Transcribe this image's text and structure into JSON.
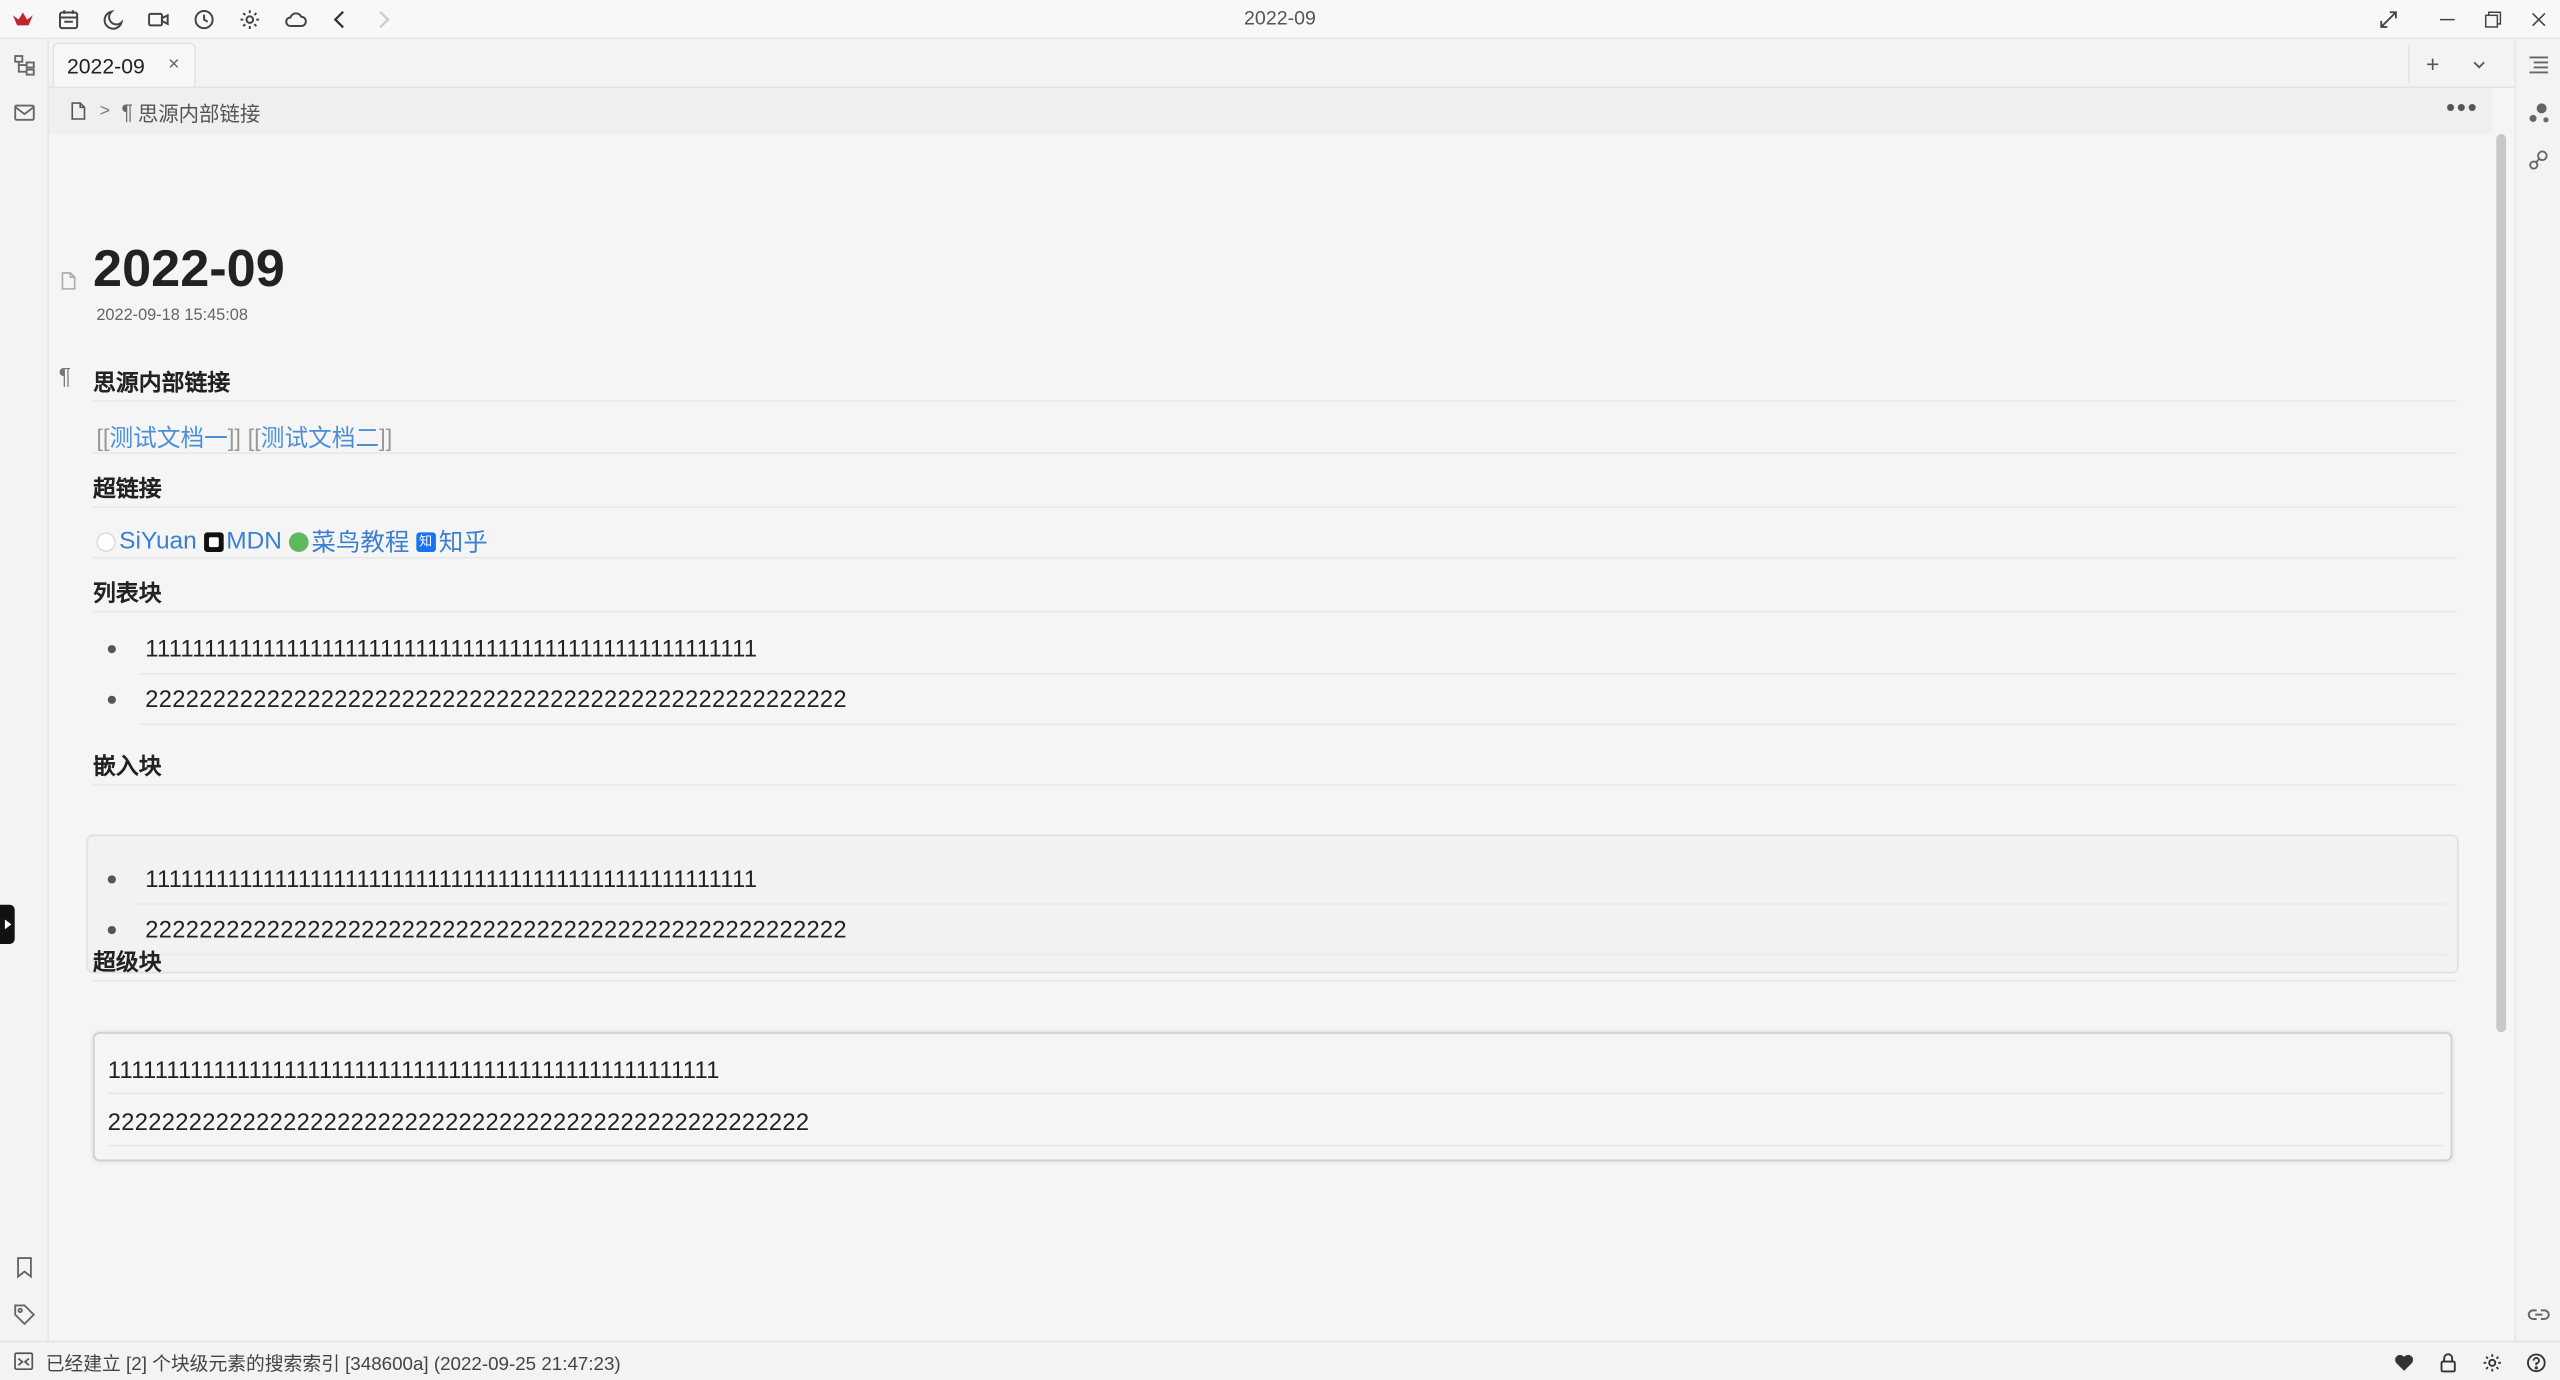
{
  "window": {
    "title": "2022-09"
  },
  "titlebar": {
    "icons": [
      "siyuan-logo-icon",
      "calendar-icon",
      "moon-icon",
      "video-icon",
      "history-icon",
      "settings-icon",
      "cloud-icon",
      "back-icon",
      "forward-icon"
    ],
    "right_icons": [
      "fullscreen-icon",
      "minimize-icon",
      "restore-icon",
      "close-icon"
    ]
  },
  "tab": {
    "label": "2022-09",
    "close": "×"
  },
  "tab_actions": {
    "add": "+",
    "dropdown": "⌄"
  },
  "breadcrumb": {
    "current": "思源内部链接",
    "more": "•••"
  },
  "doc": {
    "title": "2022-09",
    "date": "2022-09-18 15:45:08",
    "sections": {
      "internal_links_heading": "思源内部链接",
      "ref_open_1": "[[",
      "ref_1": "测试文档一",
      "ref_close_1": "]]",
      "ref_open_2": "[[",
      "ref_2": "测试文档二",
      "ref_close_2": "]]",
      "hyperlink_heading": "超链接",
      "hyperlinks": [
        "SiYuan",
        "MDN",
        "菜鸟教程",
        "知乎"
      ],
      "list_heading": "列表块",
      "list_items": [
        "1111111111111111111111111111111111111111111111111111",
        "2222222222222222222222222222222222222222222222222222"
      ],
      "embed_heading": "嵌入块",
      "embed_items": [
        "1111111111111111111111111111111111111111111111111111",
        "2222222222222222222222222222222222222222222222222222"
      ],
      "superblock_heading": "超级块",
      "superblock_lines": [
        "1111111111111111111111111111111111111111111111111111",
        "2222222222222222222222222222222222222222222222222222"
      ]
    }
  },
  "statusbar": {
    "message": "已经建立 [2] 个块级元素的搜索索引 [348600a] (2022-09-25 21:47:23)",
    "icons": [
      "heart-icon",
      "lock-icon",
      "settings-icon",
      "help-icon"
    ]
  },
  "colors": {
    "link": "#3b7fd3",
    "ref_link": "#4a90d9",
    "logo": "#c0262d"
  }
}
